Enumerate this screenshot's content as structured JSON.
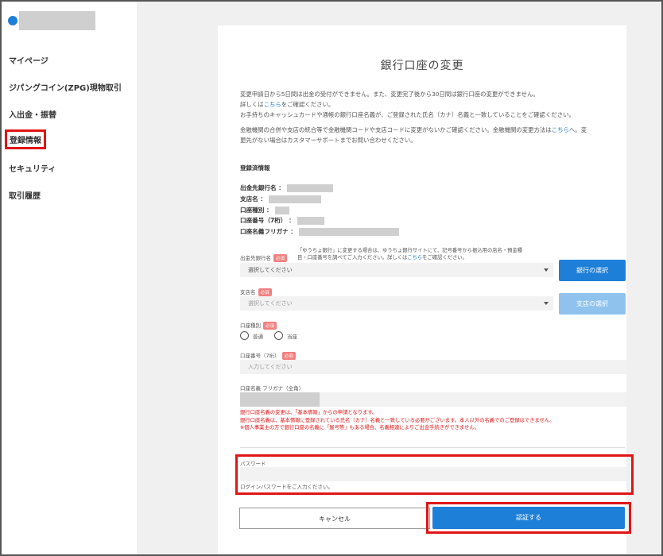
{
  "sidebar": {
    "items": [
      {
        "label": "マイページ"
      },
      {
        "label": "ジパングコイン(ZPG)現物取引"
      },
      {
        "label": "入出金・振替"
      },
      {
        "label": "登録情報"
      },
      {
        "label": "セキュリティ"
      },
      {
        "label": "取引履歴"
      }
    ]
  },
  "page": {
    "title": "銀行口座の変更",
    "note1_a": "変更申請日から5日間は出金の受付ができません。また、変更完了後から30日間は銀行口座の変更ができません。",
    "note1_b_prefix": "詳しくは",
    "note1_b_link": "こちら",
    "note1_b_suffix": "をご確認ください。",
    "note1_c": "お手持ちのキャッシュカードや通帳の銀行口座名義が、ご登録された氏名（カナ）名義と一致していることをご確認ください。",
    "note2_a": "金融機関の合併や支店の統合等で金融機関コードや支店コードに変更がないかご確認ください。金融機関の変更方法は",
    "note2_link": "こちら",
    "note2_b": "へ。変",
    "note2_c": "更先がない場合はカスタマーサポートまでお問い合わせください。",
    "registered_label": "登録済情報",
    "registered": {
      "bank_name": "出金先銀行名 ：",
      "branch_name": "支店名 ：",
      "account_type": "口座種別 ：",
      "account_number": "口座番号（7桁） ：",
      "account_holder": "口座名義フリガナ ："
    }
  },
  "form": {
    "required": "必須",
    "bank_label": "出金先銀行名",
    "bank_note_1": "「ゆうちょ銀行」に変更する場合は、ゆうちょ銀行サイトにて、記号番号から振込用の店名・預金種",
    "bank_note_2a": "目・口座番号を調べてご入力ください。詳しくは",
    "bank_note_link": "こちら",
    "bank_note_2b": "をご確認ください。",
    "bank_select": "選択してください",
    "bank_button": "銀行の選択",
    "branch_label": "支店名",
    "branch_select": "選択してください",
    "branch_button": "支店の選択",
    "account_type_label": "口座種別",
    "radio_ordinary": "普通",
    "radio_current": "当座",
    "account_number_label": "口座番号（7桁）",
    "account_number_placeholder": "入力してください",
    "holder_label": "口座名義 フリガナ（全角）",
    "warn_1": "銀行口座名義の変更は、「基本情報」からの申請となります。",
    "warn_2": "銀行口座名義は、基本情報に登録されている氏名（カナ）名義と一致している必要がございます。本人以外の名義でのご登録はできません。",
    "warn_3": "※個人事業主の方で銀行口座の名義に「屋号等」もある場合、名義相違によりご出金手続きができません。",
    "password_label": "パスワード",
    "password_hint": "ログインパスワードをご入力ください。",
    "cancel_button": "キャンセル",
    "submit_button": "認証する"
  },
  "colors": {
    "accent": "#1e7fd8",
    "highlight": "#e01515"
  }
}
